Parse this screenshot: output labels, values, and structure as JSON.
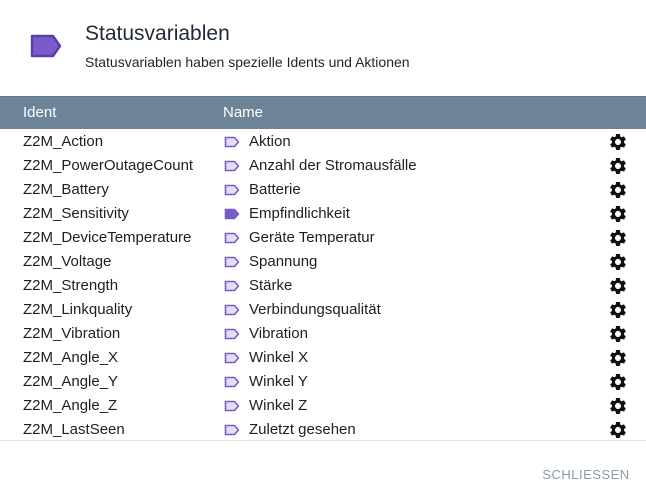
{
  "header": {
    "title": "Statusvariablen",
    "subtitle": "Statusvariablen haben spezielle Idents und Aktionen",
    "icon": "tag-icon"
  },
  "table": {
    "columns": [
      "Ident",
      "Name"
    ],
    "rows": [
      {
        "ident": "Z2M_Action",
        "name": "Aktion",
        "icon": "tag-outline"
      },
      {
        "ident": "Z2M_PowerOutageCount",
        "name": "Anzahl der Stromausfälle",
        "icon": "tag-outline"
      },
      {
        "ident": "Z2M_Battery",
        "name": "Batterie",
        "icon": "tag-outline"
      },
      {
        "ident": "Z2M_Sensitivity",
        "name": "Empfindlichkeit",
        "icon": "tag-filled"
      },
      {
        "ident": "Z2M_DeviceTemperature",
        "name": "Geräte Temperatur",
        "icon": "tag-outline"
      },
      {
        "ident": "Z2M_Voltage",
        "name": "Spannung",
        "icon": "tag-outline"
      },
      {
        "ident": "Z2M_Strength",
        "name": "Stärke",
        "icon": "tag-outline"
      },
      {
        "ident": "Z2M_Linkquality",
        "name": "Verbindungsqualität",
        "icon": "tag-outline"
      },
      {
        "ident": "Z2M_Vibration",
        "name": "Vibration",
        "icon": "tag-outline"
      },
      {
        "ident": "Z2M_Angle_X",
        "name": "Winkel X",
        "icon": "tag-outline"
      },
      {
        "ident": "Z2M_Angle_Y",
        "name": "Winkel Y",
        "icon": "tag-outline"
      },
      {
        "ident": "Z2M_Angle_Z",
        "name": "Winkel Z",
        "icon": "tag-outline"
      },
      {
        "ident": "Z2M_LastSeen",
        "name": "Zuletzt gesehen",
        "icon": "tag-outline"
      }
    ]
  },
  "footer": {
    "close_label": "SCHLIESSEN"
  },
  "colors": {
    "header_bar": "#6d8398",
    "tag_purple": "#7b5bc9",
    "tag_fill_light": "#e4ddf6",
    "close_text": "#8a9aaa"
  }
}
